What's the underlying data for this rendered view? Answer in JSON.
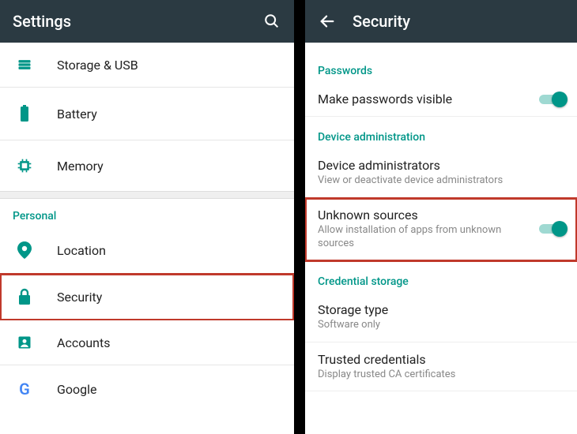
{
  "left": {
    "title": "Settings",
    "items": [
      {
        "label": "Storage & USB"
      },
      {
        "label": "Battery"
      },
      {
        "label": "Memory"
      }
    ],
    "personal_header": "Personal",
    "personal_items": [
      {
        "label": "Location"
      },
      {
        "label": "Security",
        "highlight": true
      },
      {
        "label": "Accounts"
      },
      {
        "label": "Google"
      }
    ]
  },
  "right": {
    "title": "Security",
    "sections": {
      "passwords_header": "Passwords",
      "passwords_item": {
        "label": "Make passwords visible",
        "toggle": true
      },
      "device_admin_header": "Device administration",
      "device_admin_item": {
        "label": "Device administrators",
        "sub": "View or deactivate device administrators"
      },
      "unknown_sources_item": {
        "label": "Unknown sources",
        "sub": "Allow installation of apps from unknown sources",
        "toggle": true,
        "highlight": true
      },
      "cred_header": "Credential storage",
      "storage_type_item": {
        "label": "Storage type",
        "sub": "Software only"
      },
      "trusted_item": {
        "label": "Trusted credentials",
        "sub": "Display trusted CA certificates"
      }
    }
  },
  "colors": {
    "accent": "#009688",
    "highlight": "#c0392b"
  }
}
